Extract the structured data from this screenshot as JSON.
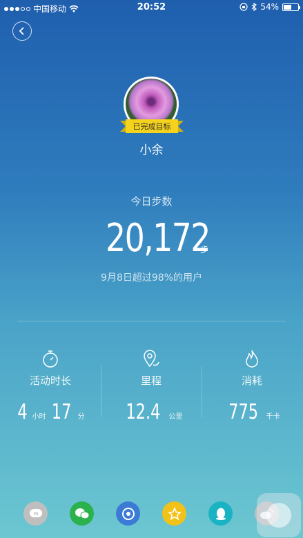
{
  "status_bar": {
    "carrier": "中国移动",
    "time": "20:52",
    "battery": "54%",
    "battery_level": 0.54
  },
  "profile": {
    "goal_badge": "已完成目标",
    "name": "小余"
  },
  "steps": {
    "label": "今日步数",
    "value": "20,172",
    "unit": "步",
    "rank": "9月8日超过98%的用户"
  },
  "stats": {
    "activity": {
      "label": "活动时长",
      "hours": "4",
      "hours_unit": "小时",
      "minutes": "17",
      "minutes_unit": "分",
      "icon": "stopwatch-icon"
    },
    "distance": {
      "label": "里程",
      "value": "12.4",
      "unit": "公里",
      "icon": "location-pin-icon"
    },
    "calories": {
      "label": "消耗",
      "value": "775",
      "unit": "千卡",
      "icon": "flame-icon"
    }
  },
  "share": [
    {
      "name": "mi-talk-share",
      "color": "#bfbfbf"
    },
    {
      "name": "wechat-share",
      "color": "#2bb24c"
    },
    {
      "name": "moments-share",
      "color": "#3b7bd6"
    },
    {
      "name": "favorites-share",
      "color": "#f3c21a"
    },
    {
      "name": "qq-share",
      "color": "#1ab3c4"
    },
    {
      "name": "weibo-share",
      "color": "#bfbfbf"
    }
  ]
}
